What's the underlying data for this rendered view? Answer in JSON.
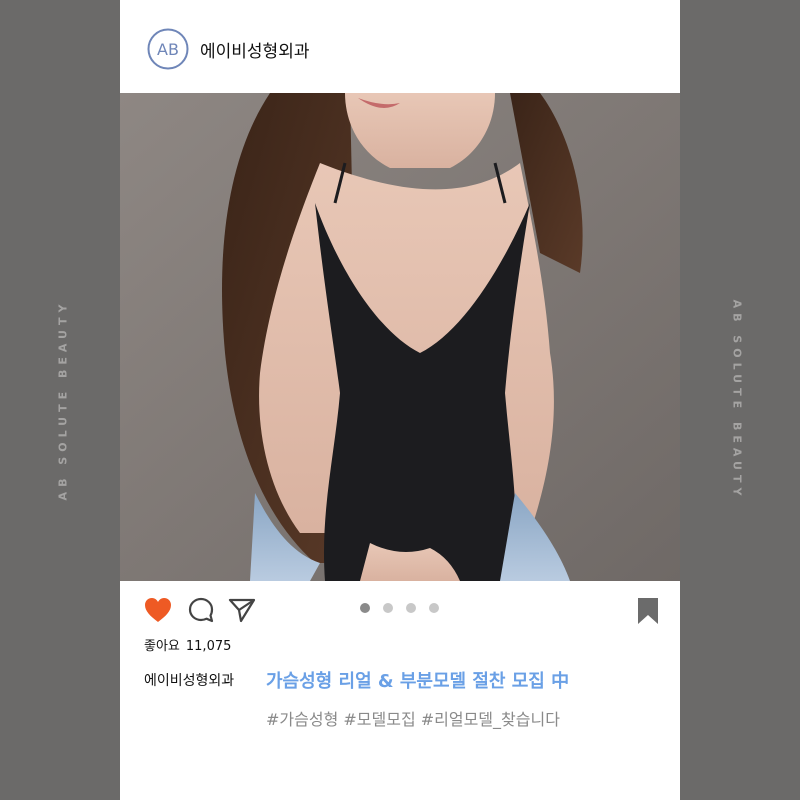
{
  "brand": {
    "side_text": "AB SOLUTE BEAUTY",
    "logo_text": "AB"
  },
  "post": {
    "account_name": "에이비성형외과",
    "likes_label": "좋아요",
    "likes_count": "11,075",
    "caption_account": "에이비성형외과",
    "caption_title": "가슴성형 리얼 & 부분모델 절찬 모집 中",
    "hashtags": "#가슴성형 #모델모집 #리얼모델_찾습니다",
    "carousel": {
      "total": 4,
      "active_index": 0
    }
  },
  "icons": {
    "like": "heart-icon",
    "comment": "comment-icon",
    "share": "share-icon",
    "save": "bookmark-icon"
  },
  "colors": {
    "background": "#6b6a69",
    "heart": "#ee5a24",
    "accent": "#6aa0e6",
    "hashtag": "#8a8a8a"
  }
}
